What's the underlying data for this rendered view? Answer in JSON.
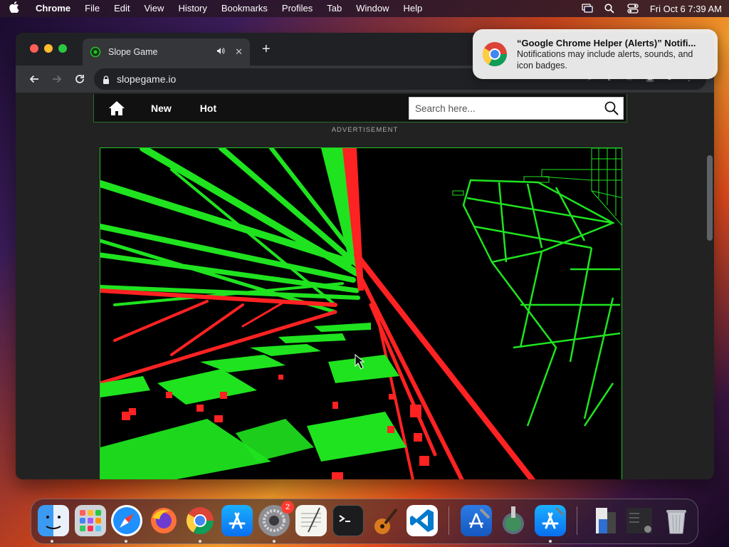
{
  "menubar": {
    "items": [
      {
        "label": "Chrome",
        "bold": true
      },
      {
        "label": "File"
      },
      {
        "label": "Edit"
      },
      {
        "label": "View"
      },
      {
        "label": "History"
      },
      {
        "label": "Bookmarks"
      },
      {
        "label": "Profiles"
      },
      {
        "label": "Tab"
      },
      {
        "label": "Window"
      },
      {
        "label": "Help"
      }
    ],
    "datetime": "Fri Oct 6  7:39 AM"
  },
  "browser": {
    "tab_title": "Slope Game",
    "url": "slopegame.io"
  },
  "site": {
    "nav": {
      "new_label": "New",
      "hot_label": "Hot"
    },
    "search_placeholder": "Search here...",
    "ad_label": "ADVERTISEMENT"
  },
  "notification": {
    "title": "“Google Chrome Helper (Alerts)” Notifi...",
    "body": "Notifications may include alerts, sounds, and icon badges."
  },
  "dock": {
    "items": [
      {
        "name": "finder",
        "running": true
      },
      {
        "name": "launchpad",
        "running": false
      },
      {
        "name": "safari",
        "running": true
      },
      {
        "name": "firefox",
        "running": false
      },
      {
        "name": "chrome",
        "running": true
      },
      {
        "name": "app-store",
        "running": false
      },
      {
        "name": "system-settings",
        "running": true,
        "badge": "2"
      },
      {
        "name": "textedit",
        "running": false
      },
      {
        "name": "terminal",
        "running": false
      },
      {
        "name": "garageband",
        "running": false
      },
      {
        "name": "vscode",
        "running": false
      },
      {
        "name": "xcode",
        "running": false
      },
      {
        "name": "migration-assistant",
        "running": false
      },
      {
        "name": "simulator",
        "running": true
      },
      {
        "name": "downloads-stack",
        "running": false
      },
      {
        "name": "trash",
        "running": false
      }
    ]
  },
  "colors": {
    "game_green": "#22ee22",
    "game_red": "#ff2222",
    "chrome_dark": "#202124"
  }
}
